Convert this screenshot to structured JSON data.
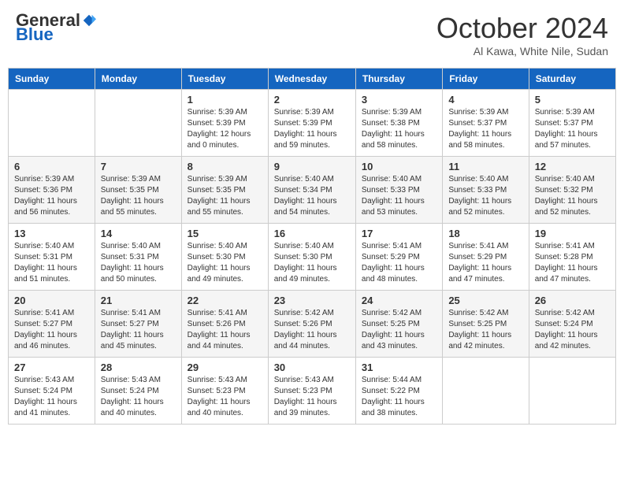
{
  "header": {
    "logo_general": "General",
    "logo_blue": "Blue",
    "month_title": "October 2024",
    "location": "Al Kawa, White Nile, Sudan"
  },
  "days_of_week": [
    "Sunday",
    "Monday",
    "Tuesday",
    "Wednesday",
    "Thursday",
    "Friday",
    "Saturday"
  ],
  "weeks": [
    [
      {
        "day": "",
        "info": ""
      },
      {
        "day": "",
        "info": ""
      },
      {
        "day": "1",
        "info": "Sunrise: 5:39 AM\nSunset: 5:39 PM\nDaylight: 12 hours and 0 minutes."
      },
      {
        "day": "2",
        "info": "Sunrise: 5:39 AM\nSunset: 5:39 PM\nDaylight: 11 hours and 59 minutes."
      },
      {
        "day": "3",
        "info": "Sunrise: 5:39 AM\nSunset: 5:38 PM\nDaylight: 11 hours and 58 minutes."
      },
      {
        "day": "4",
        "info": "Sunrise: 5:39 AM\nSunset: 5:37 PM\nDaylight: 11 hours and 58 minutes."
      },
      {
        "day": "5",
        "info": "Sunrise: 5:39 AM\nSunset: 5:37 PM\nDaylight: 11 hours and 57 minutes."
      }
    ],
    [
      {
        "day": "6",
        "info": "Sunrise: 5:39 AM\nSunset: 5:36 PM\nDaylight: 11 hours and 56 minutes."
      },
      {
        "day": "7",
        "info": "Sunrise: 5:39 AM\nSunset: 5:35 PM\nDaylight: 11 hours and 55 minutes."
      },
      {
        "day": "8",
        "info": "Sunrise: 5:39 AM\nSunset: 5:35 PM\nDaylight: 11 hours and 55 minutes."
      },
      {
        "day": "9",
        "info": "Sunrise: 5:40 AM\nSunset: 5:34 PM\nDaylight: 11 hours and 54 minutes."
      },
      {
        "day": "10",
        "info": "Sunrise: 5:40 AM\nSunset: 5:33 PM\nDaylight: 11 hours and 53 minutes."
      },
      {
        "day": "11",
        "info": "Sunrise: 5:40 AM\nSunset: 5:33 PM\nDaylight: 11 hours and 52 minutes."
      },
      {
        "day": "12",
        "info": "Sunrise: 5:40 AM\nSunset: 5:32 PM\nDaylight: 11 hours and 52 minutes."
      }
    ],
    [
      {
        "day": "13",
        "info": "Sunrise: 5:40 AM\nSunset: 5:31 PM\nDaylight: 11 hours and 51 minutes."
      },
      {
        "day": "14",
        "info": "Sunrise: 5:40 AM\nSunset: 5:31 PM\nDaylight: 11 hours and 50 minutes."
      },
      {
        "day": "15",
        "info": "Sunrise: 5:40 AM\nSunset: 5:30 PM\nDaylight: 11 hours and 49 minutes."
      },
      {
        "day": "16",
        "info": "Sunrise: 5:40 AM\nSunset: 5:30 PM\nDaylight: 11 hours and 49 minutes."
      },
      {
        "day": "17",
        "info": "Sunrise: 5:41 AM\nSunset: 5:29 PM\nDaylight: 11 hours and 48 minutes."
      },
      {
        "day": "18",
        "info": "Sunrise: 5:41 AM\nSunset: 5:29 PM\nDaylight: 11 hours and 47 minutes."
      },
      {
        "day": "19",
        "info": "Sunrise: 5:41 AM\nSunset: 5:28 PM\nDaylight: 11 hours and 47 minutes."
      }
    ],
    [
      {
        "day": "20",
        "info": "Sunrise: 5:41 AM\nSunset: 5:27 PM\nDaylight: 11 hours and 46 minutes."
      },
      {
        "day": "21",
        "info": "Sunrise: 5:41 AM\nSunset: 5:27 PM\nDaylight: 11 hours and 45 minutes."
      },
      {
        "day": "22",
        "info": "Sunrise: 5:41 AM\nSunset: 5:26 PM\nDaylight: 11 hours and 44 minutes."
      },
      {
        "day": "23",
        "info": "Sunrise: 5:42 AM\nSunset: 5:26 PM\nDaylight: 11 hours and 44 minutes."
      },
      {
        "day": "24",
        "info": "Sunrise: 5:42 AM\nSunset: 5:25 PM\nDaylight: 11 hours and 43 minutes."
      },
      {
        "day": "25",
        "info": "Sunrise: 5:42 AM\nSunset: 5:25 PM\nDaylight: 11 hours and 42 minutes."
      },
      {
        "day": "26",
        "info": "Sunrise: 5:42 AM\nSunset: 5:24 PM\nDaylight: 11 hours and 42 minutes."
      }
    ],
    [
      {
        "day": "27",
        "info": "Sunrise: 5:43 AM\nSunset: 5:24 PM\nDaylight: 11 hours and 41 minutes."
      },
      {
        "day": "28",
        "info": "Sunrise: 5:43 AM\nSunset: 5:24 PM\nDaylight: 11 hours and 40 minutes."
      },
      {
        "day": "29",
        "info": "Sunrise: 5:43 AM\nSunset: 5:23 PM\nDaylight: 11 hours and 40 minutes."
      },
      {
        "day": "30",
        "info": "Sunrise: 5:43 AM\nSunset: 5:23 PM\nDaylight: 11 hours and 39 minutes."
      },
      {
        "day": "31",
        "info": "Sunrise: 5:44 AM\nSunset: 5:22 PM\nDaylight: 11 hours and 38 minutes."
      },
      {
        "day": "",
        "info": ""
      },
      {
        "day": "",
        "info": ""
      }
    ]
  ]
}
